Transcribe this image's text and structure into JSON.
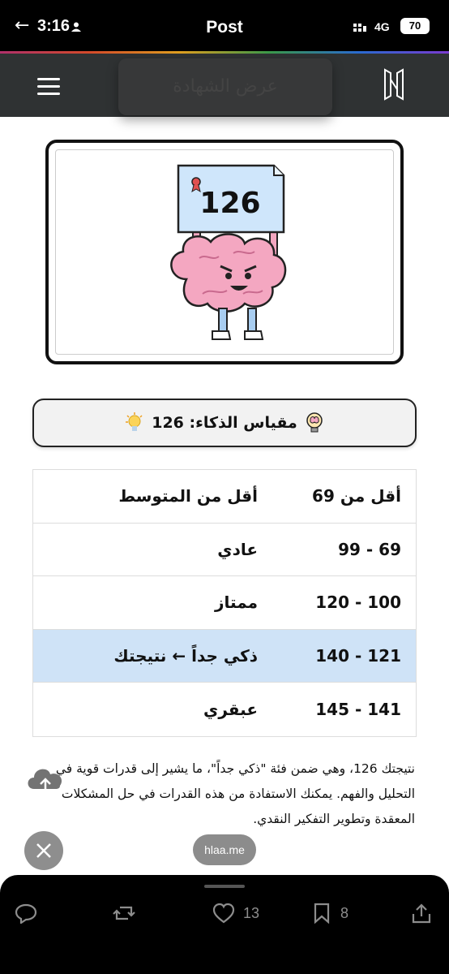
{
  "status_bar": {
    "back_glyph": "←",
    "time": "3:16",
    "title": "Post",
    "network": "4G",
    "battery": "70"
  },
  "header": {
    "certificate_button_label": "عرض الشهادة",
    "menu_icon": "hamburger-menu-icon",
    "logo_icon": "brand-logo-icon"
  },
  "image": {
    "sign_number": "126",
    "description_icon": "brain-mascot-illustration"
  },
  "iq_pill": {
    "label": "مقياس الذكاء: 126",
    "left_icon": "lightbulb-icon",
    "right_icon": "brain-bulb-icon"
  },
  "table": {
    "rows": [
      {
        "range": "أقل من 69",
        "label": "أقل من المتوسط",
        "highlight": false
      },
      {
        "range": "69 - 99",
        "label": "عادي",
        "highlight": false
      },
      {
        "range": "100 - 120",
        "label": "ممتاز",
        "highlight": false
      },
      {
        "range": "121 - 140",
        "label": "ذكي جداً ← نتيجتك",
        "highlight": true
      },
      {
        "range": "141 - 145",
        "label": "عبقري",
        "highlight": false
      }
    ],
    "highlight_color": "#cfe3f7"
  },
  "result_paragraph": "نتيجتك 126، وهي ضمن فئة \"ذكي جداً\"، ما يشير إلى قدرات قوية في التحليل والفهم. يمكنك الاستفادة من هذه القدرات في حل المشكلات المعقدة وتطوير التفكير النقدي.",
  "floating": {
    "domain": "hlaa.me",
    "close_icon": "close-icon",
    "upload_icon": "cloud-upload-icon"
  },
  "bottom_bar": {
    "like_count": "13",
    "bookmark_count": "8",
    "icons": [
      "reply-icon",
      "repost-icon",
      "like-icon",
      "bookmark-icon",
      "share-icon"
    ]
  }
}
